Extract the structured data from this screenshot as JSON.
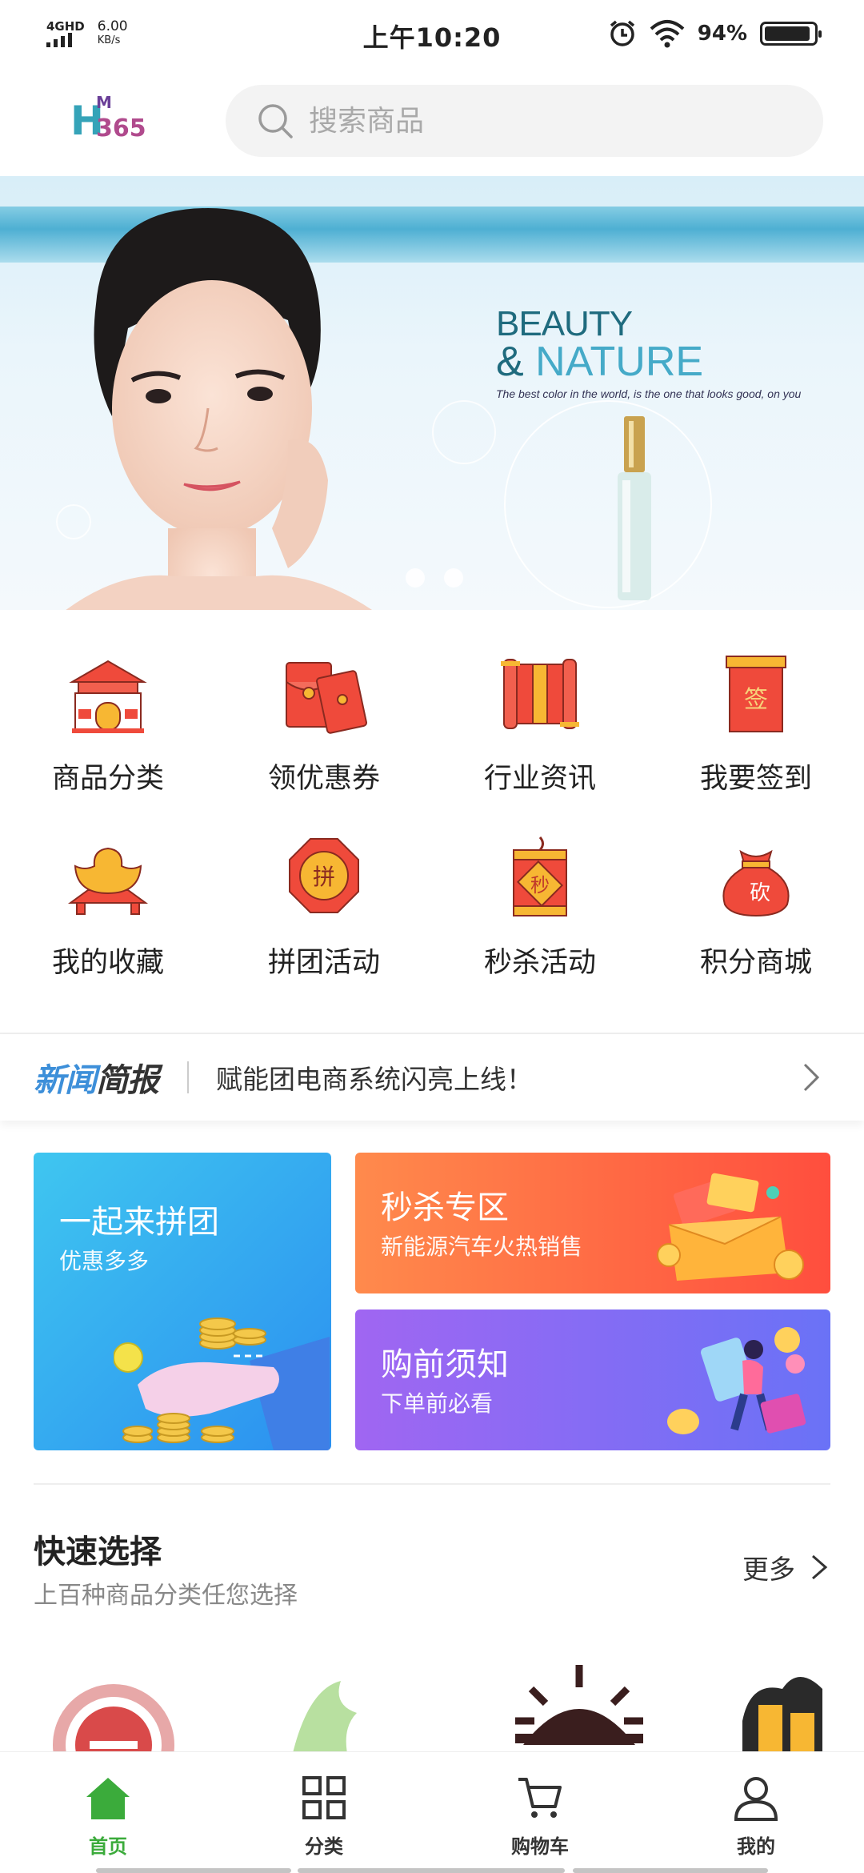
{
  "status_bar": {
    "network": "4GHD",
    "speed_value": "6.00",
    "speed_unit": "KB/s",
    "time": "上午10:20",
    "battery": "94%",
    "battery_level": 0.94
  },
  "header": {
    "logo_h": "H",
    "logo_m": "M",
    "logo_num": "365",
    "search_placeholder": "搜索商品"
  },
  "banner": {
    "title_line1": "BEAUTY",
    "title_line2_amp": "&",
    "title_line2": "NATURE",
    "tagline": "The best color in the world, is the one that looks good, on you",
    "slide_count": 2
  },
  "grid": [
    {
      "label": "商品分类",
      "icon": "temple-icon"
    },
    {
      "label": "领优惠券",
      "icon": "red-envelope-icon"
    },
    {
      "label": "行业资讯",
      "icon": "scroll-icon"
    },
    {
      "label": "我要签到",
      "icon": "sign-in-tag-icon"
    },
    {
      "label": "我的收藏",
      "icon": "gold-ingot-icon"
    },
    {
      "label": "拼团活动",
      "icon": "group-badge-icon"
    },
    {
      "label": "秒杀活动",
      "icon": "flash-sale-drum-icon"
    },
    {
      "label": "积分商城",
      "icon": "money-bag-icon"
    }
  ],
  "grid_icon_text": {
    "sign": "签",
    "group": "拼",
    "flash": "秒",
    "bag": "砍"
  },
  "news": {
    "logo_part1": "新闻",
    "logo_part2": "简报",
    "headline": "赋能团电商系统闪亮上线！"
  },
  "promos": {
    "group": {
      "title": "一起来拼团",
      "subtitle": "优惠多多"
    },
    "flash": {
      "title": "秒杀专区",
      "subtitle": "新能源汽车火热销售"
    },
    "notice": {
      "title": "购前须知",
      "subtitle": "下单前必看"
    }
  },
  "quick_select": {
    "title": "快速选择",
    "subtitle": "上百种商品分类任您选择",
    "more": "更多"
  },
  "tabbar": [
    {
      "label": "首页",
      "icon": "home-icon",
      "active": true
    },
    {
      "label": "分类",
      "icon": "grid-icon",
      "active": false
    },
    {
      "label": "购物车",
      "icon": "cart-icon",
      "active": false
    },
    {
      "label": "我的",
      "icon": "user-icon",
      "active": false
    }
  ],
  "colors": {
    "accent_green": "#3bab3b",
    "news_blue": "#3d8fd9"
  }
}
